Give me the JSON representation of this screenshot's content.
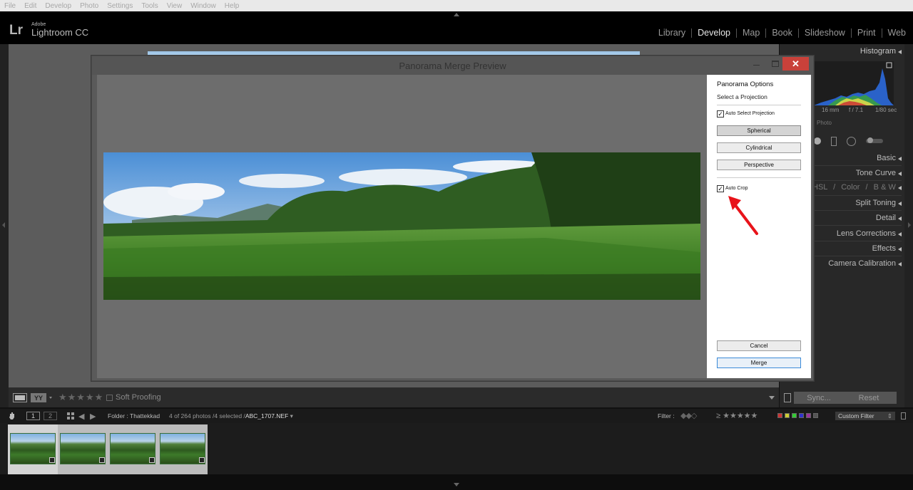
{
  "menubar": {
    "items": [
      "File",
      "Edit",
      "Develop",
      "Photo",
      "Settings",
      "Tools",
      "View",
      "Window",
      "Help"
    ]
  },
  "identity": {
    "logo": "Lr",
    "adobe": "Adobe",
    "product": "Lightroom CC"
  },
  "modules": [
    "Library",
    "Develop",
    "Map",
    "Book",
    "Slideshow",
    "Print",
    "Web"
  ],
  "active_module": "Develop",
  "right_panel": {
    "histogram_title": "Histogram",
    "exif": {
      "focal": "16 mm",
      "aperture": "f / 7.1",
      "shutter": "1/80 sec"
    },
    "original_label": "Photo",
    "sections": [
      "Basic",
      "Tone Curve",
      "Split Toning",
      "Detail",
      "Lens Corrections",
      "Effects",
      "Camera Calibration"
    ],
    "hsl": {
      "hsl": "HSL",
      "color": "Color",
      "bw": "B & W"
    },
    "sync_label": "Sync...",
    "reset_label": "Reset"
  },
  "toolbar": {
    "yy_label": "YY",
    "stars": "★★★★★",
    "soft_proofing": "Soft Proofing"
  },
  "filmstrip_header": {
    "view1": "1",
    "view2": "2",
    "folder": "Folder : Thattekkad",
    "count": "4 of 264 photos /4 selected /",
    "filename": "ABC_1707.NEF",
    "filter_label": "Filter :",
    "filter_stars": "≥ ★★★★★",
    "custom_filter": "Custom Filter"
  },
  "filmstrip": {
    "thumb_count": 4
  },
  "dialog": {
    "title": "Panorama Merge Preview",
    "close": "✕",
    "options": {
      "title": "Panorama Options",
      "projection_label": "Select a Projection",
      "auto_select": "Auto Select Projection",
      "auto_select_checked": true,
      "projections": [
        "Spherical",
        "Cylindrical",
        "Perspective"
      ],
      "selected_projection": "Spherical",
      "auto_crop": "Auto Crop",
      "auto_crop_checked": true,
      "cancel": "Cancel",
      "merge": "Merge"
    }
  },
  "colors": {
    "close_button": "#c9413a",
    "annotation_arrow": "#e8131a",
    "merge_border": "#3a8ad8"
  }
}
